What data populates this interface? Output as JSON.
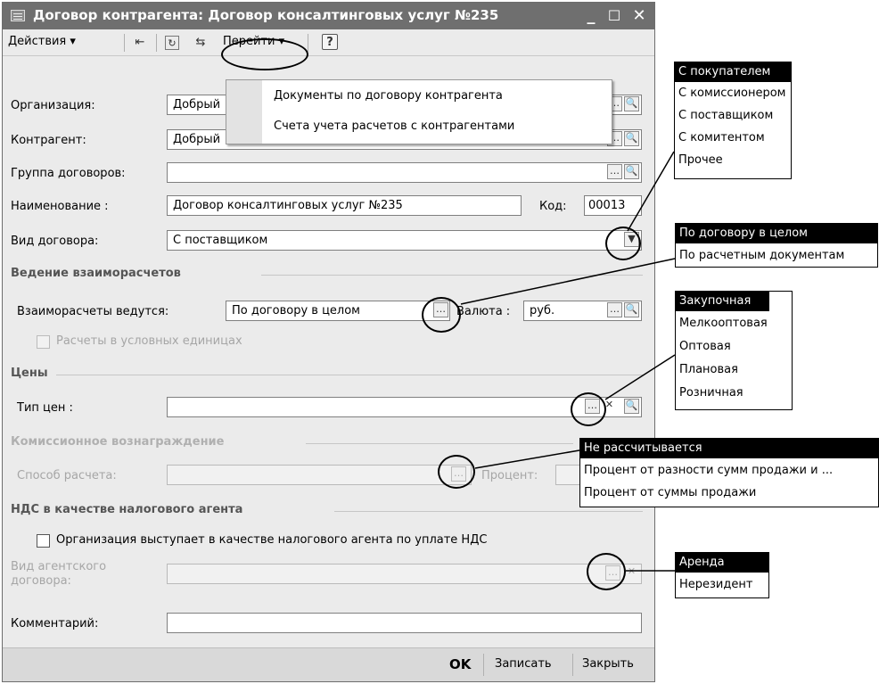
{
  "window": {
    "title": "Договор контрагента: Договор консалтинговых услуг №235",
    "minimize": "_",
    "maximize": "☐",
    "close": "✕"
  },
  "toolbar": {
    "actions": "Действия ▾",
    "goto": "Перейти ▾",
    "help": "?"
  },
  "goto_menu": [
    "Документы по договору контрагента",
    "Счета учета расчетов с контрагентами"
  ],
  "form": {
    "org_label": "Организация:",
    "org_value": "Добрый",
    "counterparty_label": "Контрагент:",
    "counterparty_value": "Добрый",
    "group_label": "Группа договоров:",
    "group_value": "",
    "name_label": "Наименование :",
    "name_value": "Договор консалтинговых услуг №235",
    "code_label": "Код:",
    "code_value": "00013",
    "kind_label": "Вид договора:",
    "kind_value": "С поставщиком",
    "settlements_section": "Ведение взаиморасчетов",
    "settlements_label": "Взаиморасчеты ведутся:",
    "settlements_value": "По договору в целом",
    "currency_label": "Валюта :",
    "currency_value": "руб.",
    "conventional_units": "Расчеты в условных единицах",
    "prices_section": "Цены",
    "price_type_label": "Тип цен :",
    "price_type_value": "",
    "commission_section": "Комиссионное вознаграждение",
    "calc_method_label": "Способ расчета:",
    "percent_label": "Процент:",
    "vat_section": "НДС в качестве налогового агента",
    "vat_agent_checkbox": "Организация выступает в качестве налогового агента по уплате НДС",
    "agent_contract_label_1": "Вид агентского",
    "agent_contract_label_2": "договора:",
    "comment_label": "Комментарий:",
    "comment_value": ""
  },
  "footer": {
    "ok": "OK",
    "save": "Записать",
    "close": "Закрыть"
  },
  "popups": {
    "contract_kinds": [
      "С покупателем",
      "С комиссионером",
      "С поставщиком",
      "С комитентом",
      "Прочее"
    ],
    "settlement_modes": [
      "По договору в целом",
      "По расчетным документам"
    ],
    "price_types": [
      "Закупочная",
      "Мелкооптовая",
      "Оптовая",
      "Плановая",
      "Розничная"
    ],
    "commission_methods": [
      "Не рассчитывается",
      "Процент от разности сумм продажи и ...",
      "Процент от суммы продажи"
    ],
    "agent_contract_kinds": [
      "Аренда",
      "Нерезидент"
    ]
  },
  "colors": {
    "title_bar": "#6f6f6f",
    "window_bg": "#ebebeb",
    "selection": "#000000"
  }
}
